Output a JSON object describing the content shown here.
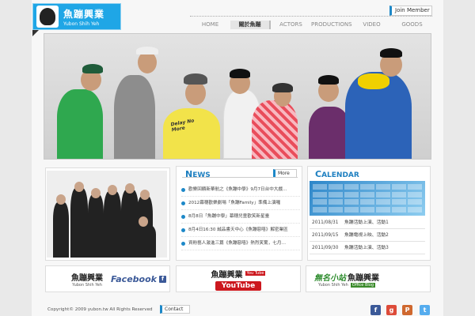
{
  "header": {
    "logo_cn": "魚蹦興業",
    "logo_en": "Yubon Shih Yeh",
    "join_label": "Join Member"
  },
  "nav": {
    "items": [
      {
        "label": "HOME"
      },
      {
        "label": "關於魚蹦"
      },
      {
        "label": "ACTORS"
      },
      {
        "label": "PRODUCTIONS"
      },
      {
        "label": "VIDEO"
      },
      {
        "label": "GOODS"
      }
    ]
  },
  "hero": {
    "shirt_text": "Delay No More"
  },
  "news": {
    "title_first": "N",
    "title_rest": "EWS",
    "more_label": "More",
    "items": [
      {
        "text": "歡樂回饋新華航之《魚蹦中學》9月7日台中大戲…"
      },
      {
        "text": "2012幕穗歡樂劇場「魚蹦Family」準備上演囉"
      },
      {
        "text": "8月8日「魚蹦中學」幕穗兒童歡笑新星臺"
      },
      {
        "text": "8月4日16:30 誠品書天中心《魚蹦惡嘻》解密業區"
      },
      {
        "text": "資粉藝人激進三篇《魚蹦惡嘻》熱烈笑驚，七月…"
      }
    ]
  },
  "calendar": {
    "title_first": "C",
    "title_rest": "ALENDAR",
    "events": [
      {
        "date": "2011/08/31",
        "text": "魚蹦活動上演、活動1"
      },
      {
        "date": "2011/09/15",
        "text": "魚蹦電視上映、活動2"
      },
      {
        "date": "2011/09/30",
        "text": "魚蹦活動上演、活動3"
      }
    ]
  },
  "banners": {
    "facebook": {
      "cn": "魚蹦興業",
      "en": "Yubon Shih Yeh",
      "brand": "Facebook",
      "badge": "f"
    },
    "youtube": {
      "cn": "魚蹦興業",
      "brand": "YouTube",
      "badge": "You Tube"
    },
    "blog": {
      "cn_left": "無名小站",
      "cn_right": "魚蹦興業",
      "en": "Yubon Shih Yeh",
      "sub": "Office Blog"
    }
  },
  "footer": {
    "copyright": "Copyright© 2009 yubon.tw All Rights Reserved",
    "contact_label": "Contact"
  },
  "social": [
    {
      "icon": "facebook-icon",
      "glyph": "f",
      "color": "#3b5998"
    },
    {
      "icon": "google-icon",
      "glyph": "g",
      "color": "#dd4b39"
    },
    {
      "icon": "plurk-icon",
      "glyph": "P",
      "color": "#cf682f"
    },
    {
      "icon": "twitter-icon",
      "glyph": "t",
      "color": "#55acee"
    }
  ],
  "colors": {
    "accent": "#1d88c8",
    "logo_bg": "#1fa6e6"
  }
}
